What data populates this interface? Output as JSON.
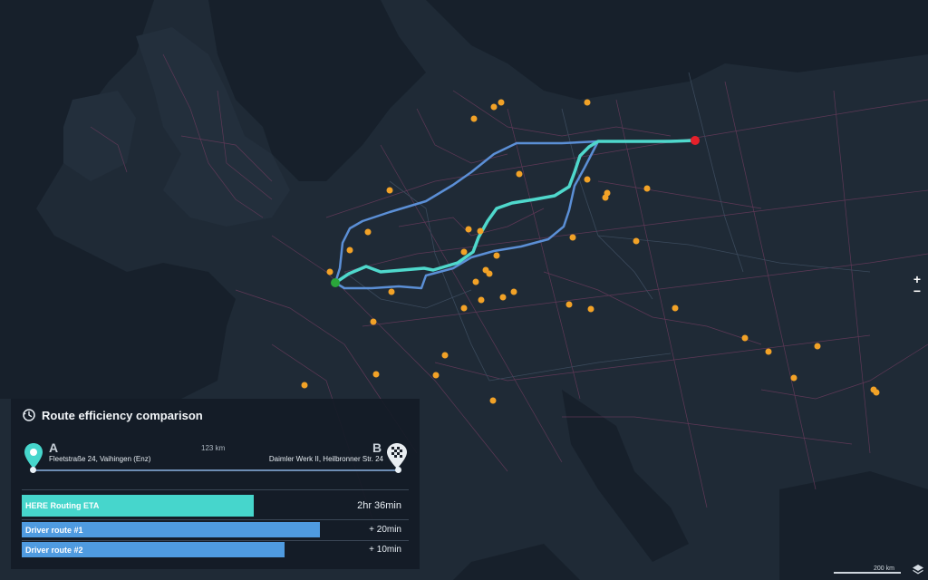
{
  "map": {
    "land_color": "#1f2a36",
    "sea_color": "#17202b",
    "road_color": "#6a3b5c",
    "suggested_route_color": "#4fd8cc",
    "alternate_route_color": "#5b8fd6",
    "poi_color": "#f2a227",
    "start_marker_color": "#2aa63a",
    "end_marker_color": "#e5202a"
  },
  "panel": {
    "title": "Route efficiency comparison",
    "title_icon": "clock-rotate-icon",
    "distance": "123 km",
    "origin": {
      "letter": "A",
      "address": "Fleetstraße 24, Vaihingen (Enz)",
      "icon": "location-pin-icon"
    },
    "destination": {
      "letter": "B",
      "address": "Daimler Werk II, Heilbronner Str. 24",
      "icon": "checkered-flag-icon"
    }
  },
  "bars": [
    {
      "label": "HERE Routing ETA",
      "value": "2hr 36min",
      "fraction": 0.6,
      "color": "#46d6cc"
    },
    {
      "label": "Driver route #1",
      "value": "+ 20min",
      "fraction": 0.77,
      "color": "#4f9be0"
    },
    {
      "label": "Driver route #2",
      "value": "+ 10min",
      "fraction": 0.68,
      "color": "#4f9be0"
    }
  ],
  "controls": {
    "zoom_in": "+",
    "zoom_out": "−",
    "scale_text": "200 km"
  }
}
